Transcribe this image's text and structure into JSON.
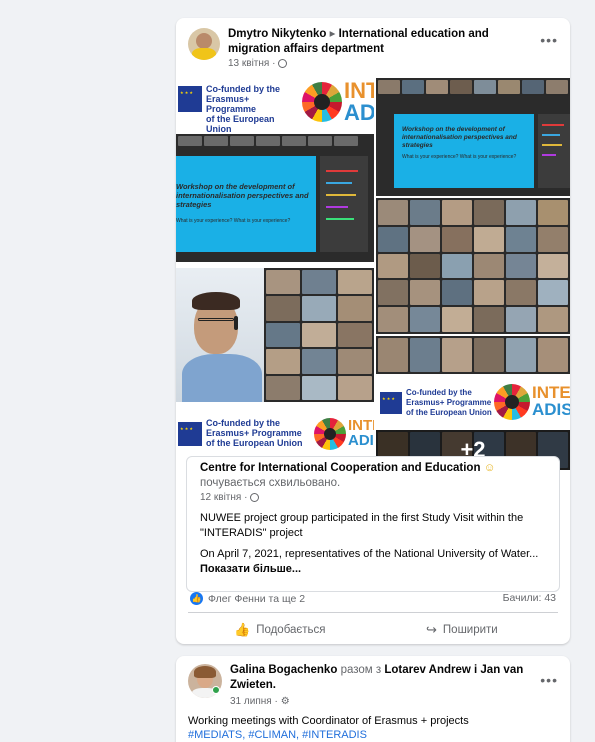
{
  "post1": {
    "author": "Dmytro Nikytenko",
    "separator": "▸",
    "group": "International education and migration affairs department",
    "timestamp": "13 квітня ·",
    "more_label": "•••",
    "photos": {
      "erasmus_line1": "Co-funded by the",
      "erasmus_line2": "Erasmus+ Programme",
      "erasmus_line3": "of the European Union",
      "inter_top": "INTER",
      "inter_bottom": "ADIS",
      "slide_title": "Workshop on the development of internationalisation perspectives and strategies",
      "slide_sub": "What is your experience? What is your experience?",
      "more_count": "+2"
    },
    "shared": {
      "page_name": "Centre for International Cooperation and Education",
      "emoji": "☺",
      "feeling": "почувається схвильовано.",
      "timestamp": "12 квітня ·",
      "text1": "NUWEE project group participated in the first Study Visit within the \"INTERADIS\" project",
      "text2": "On April 7, 2021, representatives of the National University of Water...",
      "see_more": "Показати більше..."
    },
    "reactions_text": "Флег Фенни та ще 2",
    "views_text": "Бачили: 43",
    "like_label": "Подобається",
    "share_label": "Поширити"
  },
  "post2": {
    "author": "Galina Bogachenko",
    "with_word": "разом з",
    "coauthors": "Lotarev Andrew і Jan van Zwieten.",
    "timestamp": "31 липня ·",
    "more_label": "•••",
    "text": "Working meetings with Coordinator of Erasmus  + projects",
    "hashtags": [
      "#MEDIATS,",
      "#CLIMAN,",
      "#INTERADIS"
    ]
  },
  "colors": {
    "accent": "#1877f2",
    "slide_blue": "#1ab0e6",
    "eu_blue": "#1f3b94"
  }
}
